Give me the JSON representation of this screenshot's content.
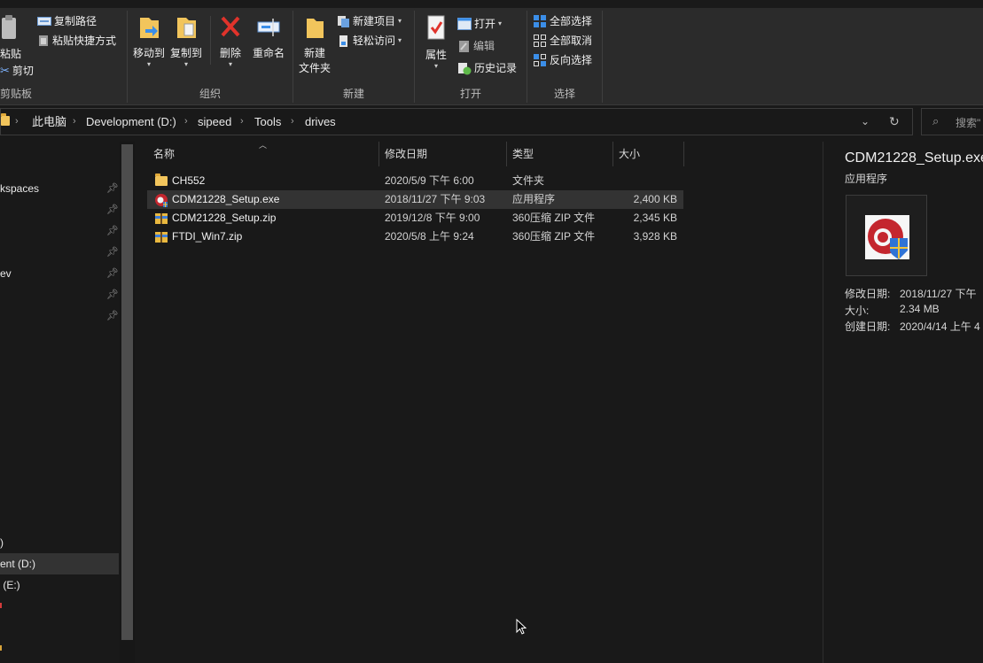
{
  "ribbon": {
    "clipboard": {
      "paste_label": "粘贴",
      "copy_path_label": "复制路径",
      "paste_shortcut_label": "粘贴快捷方式",
      "cut_label": "剪切",
      "group_label": "剪贴板"
    },
    "organize": {
      "move_to_label": "移动到",
      "copy_to_label": "复制到",
      "delete_label": "删除",
      "rename_label": "重命名",
      "group_label": "组织"
    },
    "new": {
      "new_folder_label_line1": "新建",
      "new_folder_label_line2": "文件夹",
      "new_item_label": "新建项目",
      "easy_access_label": "轻松访问",
      "group_label": "新建"
    },
    "open": {
      "properties_label": "属性",
      "open_label": "打开",
      "edit_label": "编辑",
      "history_label": "历史记录",
      "group_label": "打开"
    },
    "select": {
      "select_all_label": "全部选择",
      "select_none_label": "全部取消",
      "invert_label": "反向选择",
      "group_label": "选择"
    }
  },
  "address": {
    "crumbs": [
      "此电脑",
      "Development (D:)",
      "sipeed",
      "Tools",
      "drives"
    ],
    "search_placeholder": "搜索\""
  },
  "nav": {
    "items": [
      {
        "label": "kspaces",
        "pinned": true
      },
      {
        "label": "",
        "pinned": true
      },
      {
        "label": "",
        "pinned": true
      },
      {
        "label": "",
        "pinned": true
      },
      {
        "label": "ev",
        "pinned": true
      },
      {
        "label": "",
        "pinned": true
      },
      {
        "label": "",
        "pinned": true
      }
    ],
    "drives": [
      {
        "label": ")"
      },
      {
        "label": "ent (D:)",
        "selected": true
      },
      {
        "label": " (E:)"
      }
    ]
  },
  "list": {
    "headers": {
      "name": "名称",
      "date": "修改日期",
      "type": "类型",
      "size": "大小"
    },
    "rows": [
      {
        "name": "CH552",
        "date": "2020/5/9 下午 6:00",
        "type": "文件夹",
        "size": "",
        "icon": "folder-icon"
      },
      {
        "name": "CDM21228_Setup.exe",
        "date": "2018/11/27 下午 9:03",
        "type": "应用程序",
        "size": "2,400 KB",
        "icon": "exe-icon",
        "selected": true
      },
      {
        "name": "CDM21228_Setup.zip",
        "date": "2019/12/8 下午 9:00",
        "type": "360压缩 ZIP 文件",
        "size": "2,345 KB",
        "icon": "zip-icon"
      },
      {
        "name": "FTDI_Win7.zip",
        "date": "2020/5/8 上午 9:24",
        "type": "360压缩 ZIP 文件",
        "size": "3,928 KB",
        "icon": "zip-icon"
      }
    ]
  },
  "preview": {
    "filename": "CDM21228_Setup.exe",
    "filetype": "应用程序",
    "modified_label": "修改日期:",
    "modified_value": "2018/11/27 下午",
    "size_label": "大小:",
    "size_value": "2.34 MB",
    "created_label": "创建日期:",
    "created_value": "2020/4/14 上午 4"
  }
}
